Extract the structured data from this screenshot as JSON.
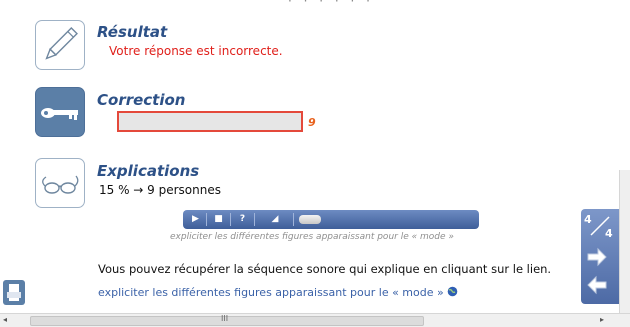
{
  "top_dots": "· · · · · ·",
  "resultat": {
    "title": "Résultat",
    "message": "Votre réponse est incorrecte."
  },
  "correction": {
    "title": "Correction",
    "answer_value": "",
    "answer_hint": "9"
  },
  "explications": {
    "title": "Explications",
    "formula": "15 % → 9 personnes"
  },
  "player": {
    "caption": "expliciter les différentes figures apparaissant pour le « mode »",
    "play": "▶",
    "stop": "■",
    "help": "?",
    "volume": "◢"
  },
  "sound_text": "Vous pouvez récupérer la séquence sonore qui explique en cliquant sur le lien.",
  "sound_link": "expliciter les différentes figures apparaissant pour le « mode »",
  "page_indicator": {
    "current": "4",
    "total": "4"
  },
  "hscroll_grip": "III",
  "colors": {
    "title": "#2d5187",
    "error": "#e0201b",
    "link": "#3b62a8",
    "panel": "#5b7fa7"
  }
}
